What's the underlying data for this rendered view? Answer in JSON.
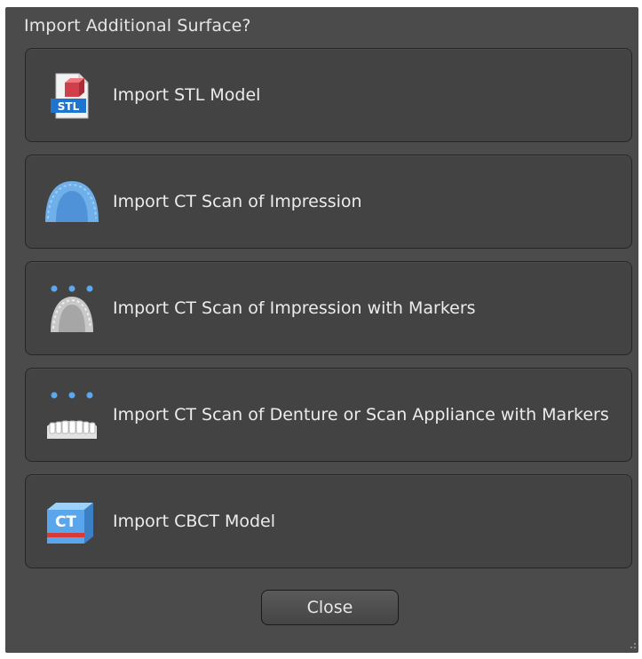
{
  "dialog": {
    "title": "Import Additional Surface?",
    "options": [
      {
        "label": "Import STL Model",
        "icon": "stl-file-icon"
      },
      {
        "label": "Import CT Scan of Impression",
        "icon": "impression-icon"
      },
      {
        "label": "Import CT Scan of Impression with Markers",
        "icon": "impression-markers-icon"
      },
      {
        "label": "Import CT Scan of Denture or Scan Appliance with Markers",
        "icon": "denture-markers-icon"
      },
      {
        "label": "Import CBCT Model",
        "icon": "cbct-icon"
      }
    ],
    "close_label": "Close"
  },
  "icon_text": {
    "stl": "STL",
    "cbct": "CT"
  },
  "colors": {
    "background": "#4b4b4b",
    "button": "#434343",
    "accent_blue": "#4a90e2"
  }
}
